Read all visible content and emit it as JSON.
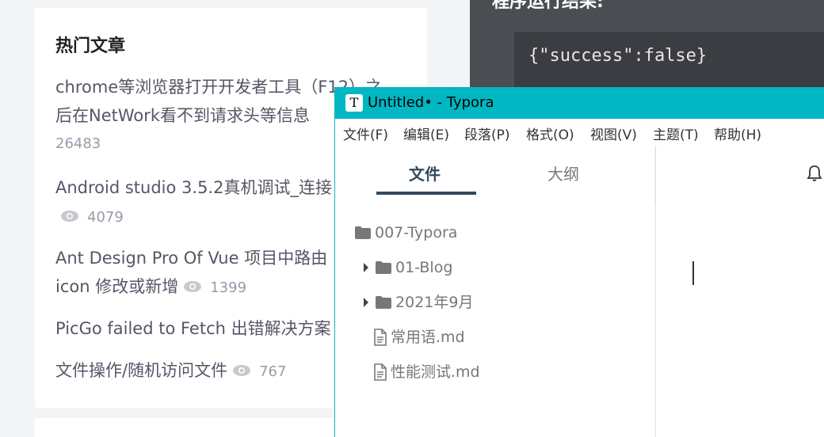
{
  "blog": {
    "hot_title": "热门文章",
    "articles": [
      {
        "line1": "chrome等浏览器打开开发者工具（F12）之",
        "line2": "后在NetWork看不到请求头等信息",
        "views": "26483"
      },
      {
        "line1": "Android studio 3.5.2真机调试_连接",
        "views": "4079"
      },
      {
        "line1": "Ant Design Pro Of Vue 项目中路由",
        "line2": "icon 修改或新增",
        "views": "1399"
      },
      {
        "line1": "PicGo failed to Fetch 出错解决方案"
      },
      {
        "line1": "文件操作/随机访问文件",
        "views": "767"
      }
    ]
  },
  "code_panel": {
    "heading": "程序运行结果:",
    "code": "{\"success\":false}"
  },
  "typora": {
    "title": "Untitled• - Typora",
    "app_icon_letter": "T",
    "menu": [
      "文件(F)",
      "编辑(E)",
      "段落(P)",
      "格式(O)",
      "视图(V)",
      "主题(T)",
      "帮助(H)"
    ],
    "tabs": {
      "files": "文件",
      "outline": "大纲"
    },
    "tree": {
      "root": "007-Typora",
      "folders": [
        "01-Blog",
        "2021年9月"
      ],
      "files": [
        "常用语.md",
        "性能测试.md"
      ]
    }
  },
  "colors": {
    "titlebar": "#00b7c3",
    "tab_active": "#34495e"
  }
}
